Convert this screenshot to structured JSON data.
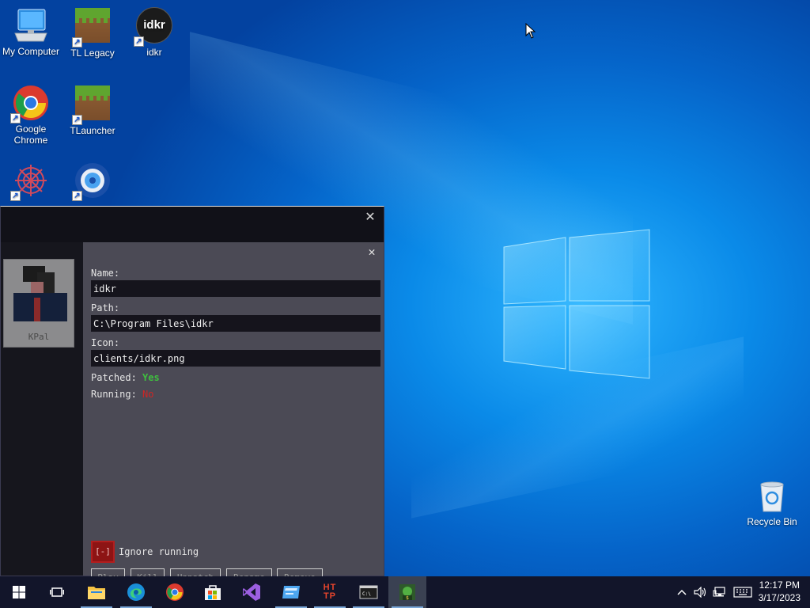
{
  "desktop": {
    "icons": [
      {
        "label": "My Computer",
        "icon": "computer-icon"
      },
      {
        "label": "TL Legacy",
        "icon": "minecraft-grass-icon"
      },
      {
        "label": "idkr",
        "icon": "idkr-icon",
        "glyph": "idkr"
      },
      {
        "label": "Google Chrome",
        "icon": "chrome-icon"
      },
      {
        "label": "TLauncher",
        "icon": "minecraft-grass-icon"
      },
      {
        "label": "",
        "icon": "red-flower-icon"
      },
      {
        "label": "",
        "icon": "disc-icon"
      }
    ],
    "recycle_bin": {
      "label": "Recycle Bin"
    }
  },
  "app": {
    "client_card": {
      "label": "KPal"
    },
    "detail": {
      "name_label": "Name:",
      "name_value": "idkr",
      "path_label": "Path:",
      "path_value": "C:\\Program Files\\idkr",
      "icon_label": "Icon:",
      "icon_value": "clients/idkr.png",
      "patched_label": "Patched:",
      "patched_value": "Yes",
      "running_label": "Running:",
      "running_value": "No",
      "ignore_box": "[-]",
      "ignore_label": "Ignore running",
      "buttons": [
        "Play",
        "Kill",
        "Unpatch",
        "Rename",
        "Remove"
      ]
    },
    "close_glyph": "✕"
  },
  "taskbar": {
    "apps": [
      "start",
      "task-view",
      "file-explorer",
      "edge",
      "chrome",
      "store",
      "visual-studio",
      "app-blue",
      "http-toolkit",
      "terminal",
      "kpal"
    ],
    "clock": {
      "time": "12:17 PM",
      "date": "3/17/2023"
    }
  },
  "colors": {
    "accent": "#0a8ae8",
    "taskbar": "#12152a",
    "panel": "#4b4a55",
    "yes": "#3fbf3f",
    "no": "#d02525"
  }
}
